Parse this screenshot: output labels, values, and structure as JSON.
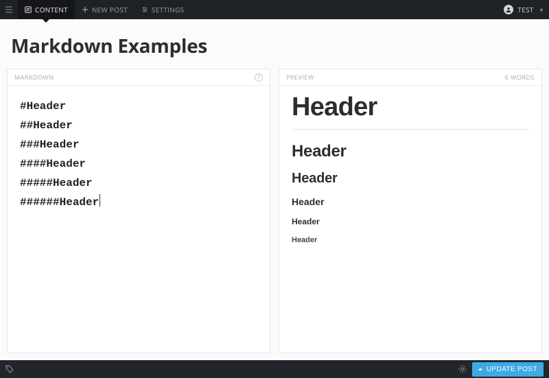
{
  "nav": {
    "items": [
      {
        "label": "CONTENT",
        "icon": "content-icon"
      },
      {
        "label": "NEW POST",
        "icon": "plus-icon"
      },
      {
        "label": "SETTINGS",
        "icon": "sliders-icon"
      }
    ],
    "user": {
      "name": "TEST"
    }
  },
  "post": {
    "title": "Markdown Examples"
  },
  "editor": {
    "header_label": "MARKDOWN",
    "lines": [
      "#Header",
      "##Header",
      "###Header",
      "####Header",
      "#####Header",
      "######Header"
    ]
  },
  "preview": {
    "header_label": "PREVIEW",
    "word_count_label": "6 WORDS",
    "items": [
      {
        "level": 1,
        "text": "Header"
      },
      {
        "level": 2,
        "text": "Header"
      },
      {
        "level": 3,
        "text": "Header"
      },
      {
        "level": 4,
        "text": "Header"
      },
      {
        "level": 5,
        "text": "Header"
      },
      {
        "level": 6,
        "text": "Header"
      }
    ]
  },
  "footer": {
    "update_label": "UPDATE POST"
  }
}
